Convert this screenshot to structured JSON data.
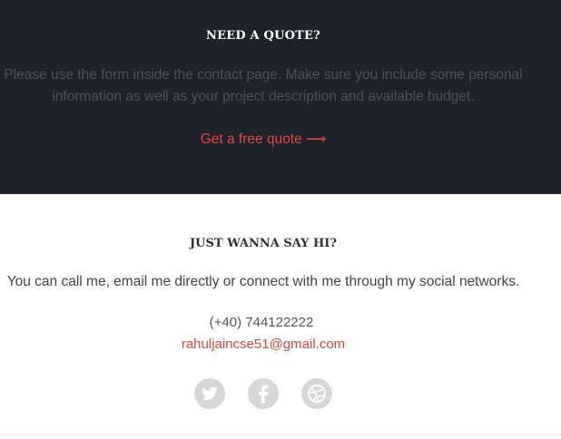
{
  "quote": {
    "title": "NEED A QUOTE?",
    "text": "Please use the form inside the contact page. Make sure you include some personal information as well as your project description and available budget.",
    "link_label": "Get a free quote ⟶"
  },
  "contact": {
    "title": "JUST WANNA SAY HI?",
    "text": "You can call me, email me directly or connect with me through my social networks.",
    "phone": "(+40) 744122222",
    "email": "rahuljaincse51@gmail.com"
  },
  "social": [
    {
      "icon": "twitter-icon"
    },
    {
      "icon": "facebook-icon"
    },
    {
      "icon": "dribbble-icon"
    }
  ],
  "colors": {
    "dark_background": "#1d222b",
    "accent": "#e0463f",
    "icon_circle": "#d7d7d7"
  }
}
